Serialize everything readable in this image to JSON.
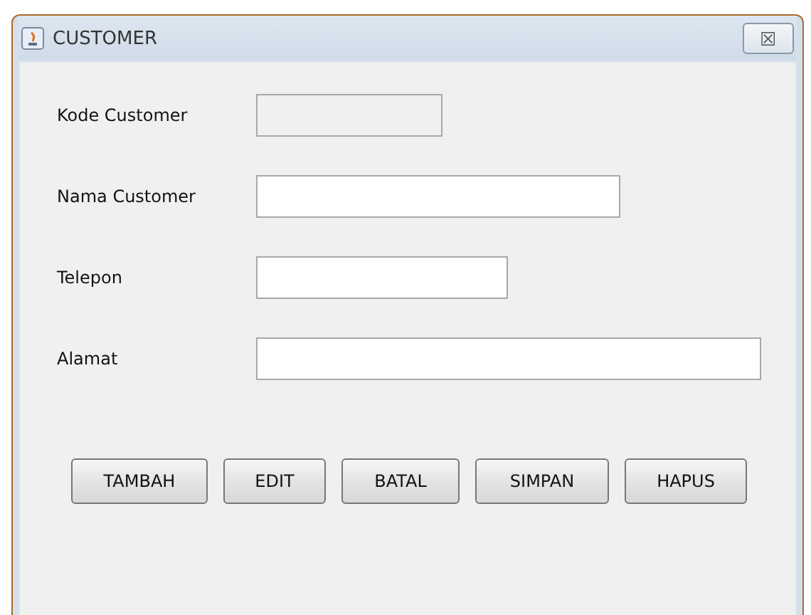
{
  "window": {
    "title": "CUSTOMER",
    "close": "☒"
  },
  "fields": [
    {
      "label": "Kode Customer",
      "disabled": true
    },
    {
      "label": "Nama Customer",
      "disabled": false
    },
    {
      "label": "Telepon",
      "disabled": false
    },
    {
      "label": "Alamat",
      "disabled": false
    }
  ],
  "buttons": [
    "TAMBAH",
    "EDIT",
    "BATAL",
    "SIMPAN",
    "HAPUS"
  ]
}
